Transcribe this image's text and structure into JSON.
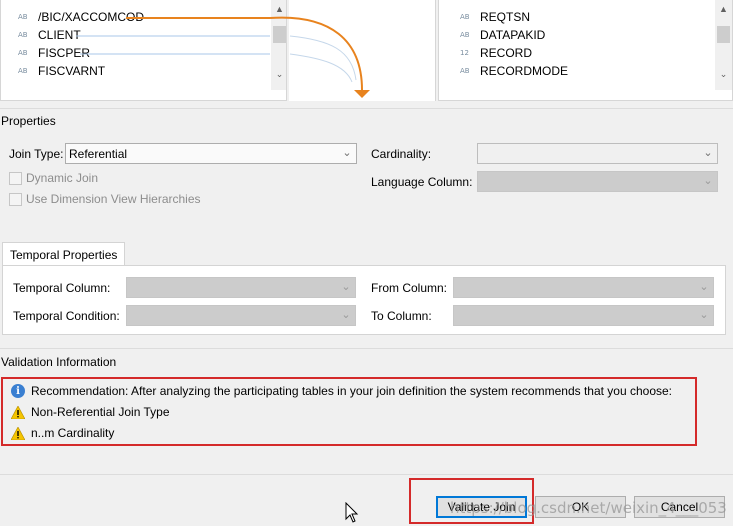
{
  "left_columns": [
    {
      "type": "AB",
      "name": "/BIC/XACCOMCOD"
    },
    {
      "type": "AB",
      "name": "CLIENT"
    },
    {
      "type": "AB",
      "name": "FISCPER"
    },
    {
      "type": "AB",
      "name": "FISCVARNT"
    }
  ],
  "right_columns": [
    {
      "type": "AB",
      "name": "REQTSN"
    },
    {
      "type": "AB",
      "name": "DATAPAKID"
    },
    {
      "type": "12",
      "name": "RECORD"
    },
    {
      "type": "AB",
      "name": "RECORDMODE"
    }
  ],
  "properties": {
    "title": "Properties",
    "join_type_label": "Join Type:",
    "join_type_value": "Referential",
    "cardinality_label": "Cardinality:",
    "cardinality_value": "",
    "language_column_label": "Language Column:",
    "language_column_value": "",
    "dynamic_join_label": "Dynamic Join",
    "dynamic_join_checked": false,
    "use_dim_label": "Use Dimension View Hierarchies",
    "use_dim_checked": false
  },
  "temporal": {
    "tab_label": "Temporal Properties",
    "temporal_column_label": "Temporal Column:",
    "temporal_condition_label": "Temporal Condition:",
    "from_column_label": "From Column:",
    "to_column_label": "To Column:"
  },
  "validation": {
    "title": "Validation Information",
    "messages": [
      {
        "icon": "info-icon",
        "text": "Recommendation: After analyzing the participating tables in your join definition the system recommends that you choose:"
      },
      {
        "icon": "warning-icon",
        "text": "Non-Referential Join Type"
      },
      {
        "icon": "warning-icon",
        "text": "n..m Cardinality"
      }
    ]
  },
  "buttons": {
    "validate_join": "Validate Join",
    "ok": "OK",
    "cancel": "Cancel"
  },
  "watermark": "https://blog.csdn.net/weixin_4___053",
  "colors": {
    "accent_orange": "#e8831e",
    "highlight_red": "#d42a2a",
    "info_blue": "#3a7fd1",
    "warning_yellow": "#f5c400"
  }
}
